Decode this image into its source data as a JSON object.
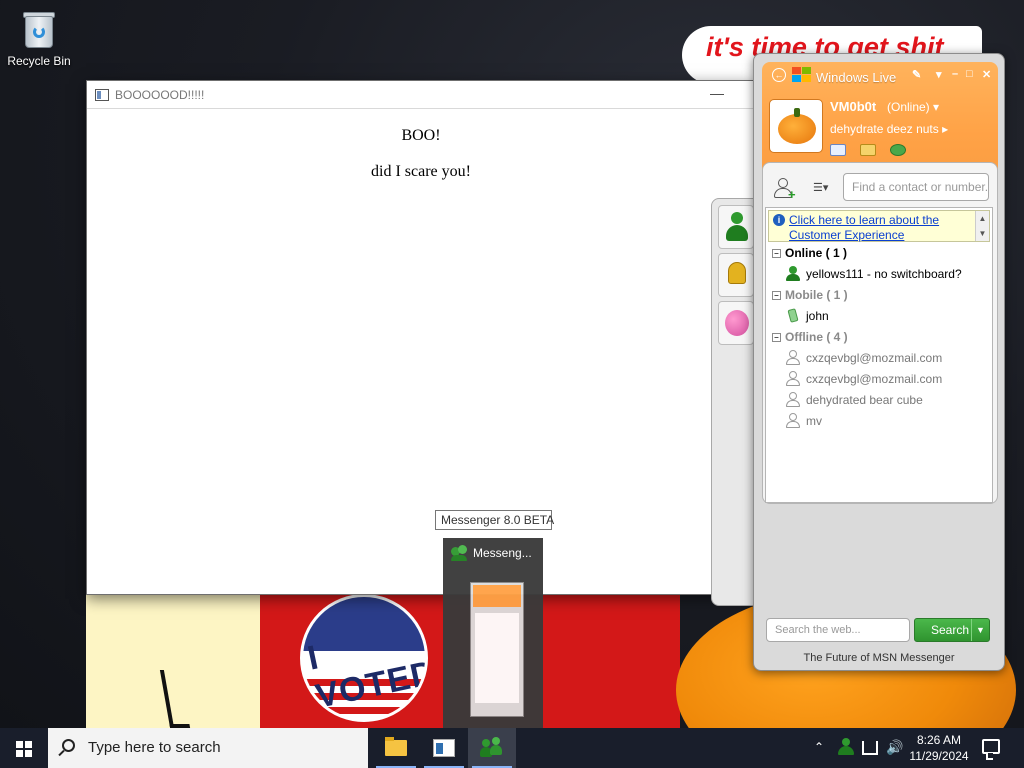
{
  "desktop": {
    "icons": [
      {
        "label": "Recycle Bin",
        "icon": "recycle-bin-icon"
      }
    ],
    "wallpaper_text": "it's time to get shit",
    "wallpaper_badge": "I VOTED"
  },
  "browser_window": {
    "title": "BOOOOOOD!!!!!",
    "lines": [
      "BOO!",
      "did I scare you!"
    ]
  },
  "messenger": {
    "brand": "Windows Live",
    "user": {
      "name": "VM0b0t",
      "status": "(Online)",
      "personal_message": "dehydrate deez nuts"
    },
    "find_placeholder": "Find a contact or number...",
    "info_bar": "Click here to learn about the Customer Experience",
    "groups": [
      {
        "label": "Online ( 1 )",
        "contacts": [
          {
            "name": "yellows111 - no switchboard?",
            "state": "online"
          }
        ]
      },
      {
        "label": "Mobile ( 1 )",
        "contacts": [
          {
            "name": "john",
            "state": "mobile"
          }
        ]
      },
      {
        "label": "Offline ( 4 )",
        "contacts": [
          {
            "name": "cxzqevbgl@mozmail.com",
            "state": "offline"
          },
          {
            "name": "cxzqevbgl@mozmail.com",
            "state": "offline"
          },
          {
            "name": "dehydrated bear cube",
            "state": "offline"
          },
          {
            "name": "mv",
            "state": "offline"
          }
        ]
      }
    ],
    "web_search_placeholder": "Search the web...",
    "search_button": "Search",
    "footer": "The Future of MSN Messenger",
    "colors": {
      "header": "#ffa246",
      "search_button": "#2f942f",
      "link": "#0a3fd0"
    }
  },
  "taskbar": {
    "search_placeholder": "Type here to search",
    "tooltip": "Messenger 8.0 BETA",
    "preview_title": "Messeng...",
    "apps": [
      "file-explorer-icon",
      "window-app-icon",
      "messenger-icon"
    ],
    "clock_time": "8:26 AM",
    "clock_date": "11/29/2024"
  }
}
